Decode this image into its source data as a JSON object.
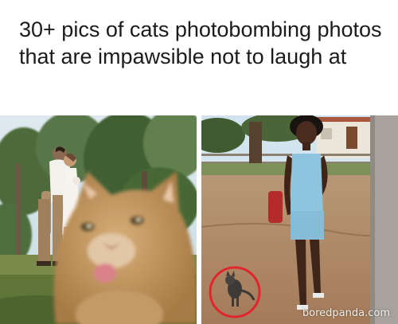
{
  "post": {
    "title": "30+ pics of cats photobombing photos that are impawsible not to laugh at"
  },
  "watermark": {
    "text": "boredpanda.com"
  },
  "colors": {
    "highlight_circle": "#e0262c",
    "sky": "#cfe3ee",
    "cat_fur": "#c99a5c",
    "dirt": "#b98f6e",
    "romper": "#8fc4df"
  }
}
